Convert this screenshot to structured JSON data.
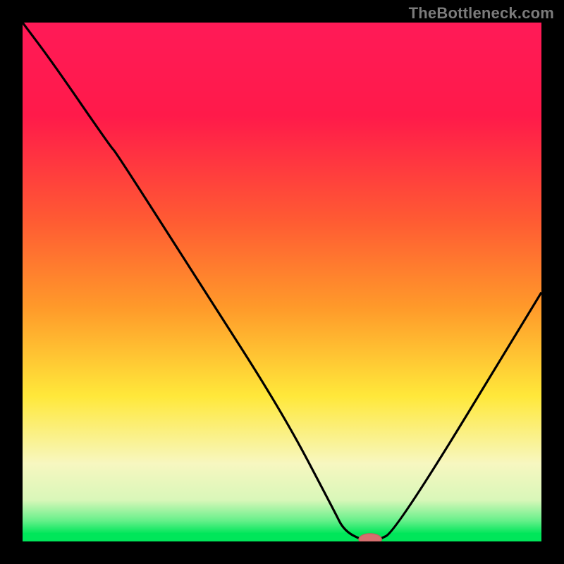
{
  "attribution": "TheBottleneck.com",
  "colors": {
    "bg": "#000000",
    "curve": "#000000",
    "marker_fill": "#d66f6f",
    "marker_stroke": "#c55f5f",
    "green_band": "#00e65a",
    "green_band2": "#66f08a",
    "pale_green": "#d9f7b9",
    "cream": "#f7f7c0",
    "yellow": "#ffe83a",
    "orange": "#ff9a2a",
    "red_orange": "#ff5a33",
    "red": "#ff1a4a",
    "magenta": "#ff1a57"
  },
  "chart_data": {
    "type": "line",
    "title": "",
    "xlabel": "",
    "ylabel": "",
    "xlim": [
      0,
      100
    ],
    "ylim": [
      0,
      100
    ],
    "series": [
      {
        "name": "bottleneck-curve",
        "x": [
          0,
          6,
          17,
          18,
          34,
          50,
          60,
          62,
          66,
          68,
          72,
          100
        ],
        "values": [
          100,
          92,
          76,
          75,
          50,
          25,
          6,
          2,
          0,
          0,
          2,
          48
        ]
      }
    ],
    "marker": {
      "x": 67,
      "y": 0,
      "rx": 2.2,
      "ry": 1.1
    }
  }
}
